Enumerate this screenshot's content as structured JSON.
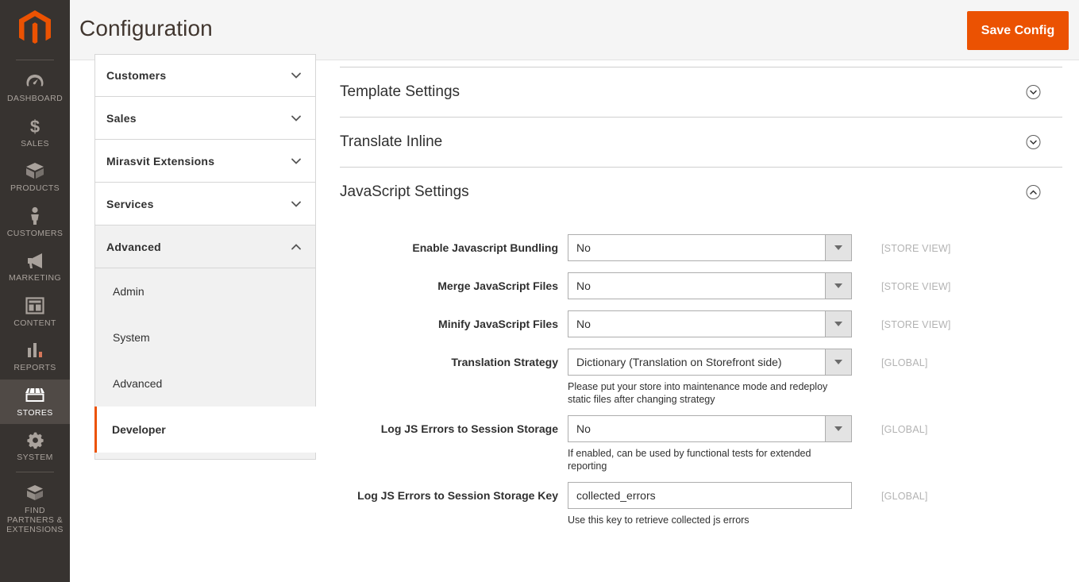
{
  "admin_nav": {
    "logo_name": "magento-logo",
    "items": [
      {
        "label": "Dashboard",
        "icon": "dashboard-gauge-icon",
        "active": false
      },
      {
        "label": "Sales",
        "icon": "dollar-sign-icon",
        "active": false
      },
      {
        "label": "Products",
        "icon": "box-icon",
        "active": false
      },
      {
        "label": "Customers",
        "icon": "person-icon",
        "active": false
      },
      {
        "label": "Marketing",
        "icon": "megaphone-icon",
        "active": false
      },
      {
        "label": "Content",
        "icon": "layout-page-icon",
        "active": false
      },
      {
        "label": "Reports",
        "icon": "bar-chart-icon",
        "active": false
      },
      {
        "label": "Stores",
        "icon": "storefront-awning-icon",
        "active": true
      },
      {
        "label": "System",
        "icon": "gear-icon",
        "active": false
      },
      {
        "label": "Find Partners & Extensions",
        "icon": "extension-box-icon",
        "active": false
      }
    ]
  },
  "header": {
    "title": "Configuration",
    "save_label": "Save Config"
  },
  "config_tree": {
    "sections": [
      {
        "label": "Customers",
        "open": false,
        "chevron": "chevron-down-icon"
      },
      {
        "label": "Sales",
        "open": false,
        "chevron": "chevron-down-icon"
      },
      {
        "label": "Mirasvit Extensions",
        "open": false,
        "chevron": "chevron-down-icon"
      },
      {
        "label": "Services",
        "open": false,
        "chevron": "chevron-down-icon"
      },
      {
        "label": "Advanced",
        "open": true,
        "chevron": "chevron-up-icon"
      }
    ],
    "sub_items": [
      {
        "label": "Admin",
        "active": false
      },
      {
        "label": "System",
        "active": false
      },
      {
        "label": "Advanced",
        "active": false
      },
      {
        "label": "Developer",
        "active": true
      }
    ]
  },
  "settings": {
    "sections": [
      {
        "title": "Template Settings",
        "expanded": false,
        "toggle_icon": "circle-chevron-down-icon"
      },
      {
        "title": "Translate Inline",
        "expanded": false,
        "toggle_icon": "circle-chevron-down-icon"
      },
      {
        "title": "JavaScript Settings",
        "expanded": true,
        "toggle_icon": "circle-chevron-up-icon"
      }
    ],
    "javascript_fields": [
      {
        "label": "Enable Javascript Bundling",
        "type": "select",
        "value": "No",
        "scope": "[STORE VIEW]",
        "hint": ""
      },
      {
        "label": "Merge JavaScript Files",
        "type": "select",
        "value": "No",
        "scope": "[STORE VIEW]",
        "hint": ""
      },
      {
        "label": "Minify JavaScript Files",
        "type": "select",
        "value": "No",
        "scope": "[STORE VIEW]",
        "hint": ""
      },
      {
        "label": "Translation Strategy",
        "type": "select",
        "value": "Dictionary (Translation on Storefront side)",
        "scope": "[GLOBAL]",
        "hint": "Please put your store into maintenance mode and redeploy static files after changing strategy"
      },
      {
        "label": "Log JS Errors to Session Storage",
        "type": "select",
        "value": "No",
        "scope": "[GLOBAL]",
        "hint": "If enabled, can be used by functional tests for extended reporting"
      },
      {
        "label": "Log JS Errors to Session Storage Key",
        "type": "text",
        "value": "collected_errors",
        "scope": "[GLOBAL]",
        "hint": "Use this key to retrieve collected js errors"
      }
    ]
  },
  "colors": {
    "brand_orange": "#eb5202",
    "nav_background": "#373330",
    "nav_active": "#504a46",
    "header_background": "#f5f5f5",
    "text_primary": "#303030",
    "scope_note": "#b3b3b3"
  }
}
